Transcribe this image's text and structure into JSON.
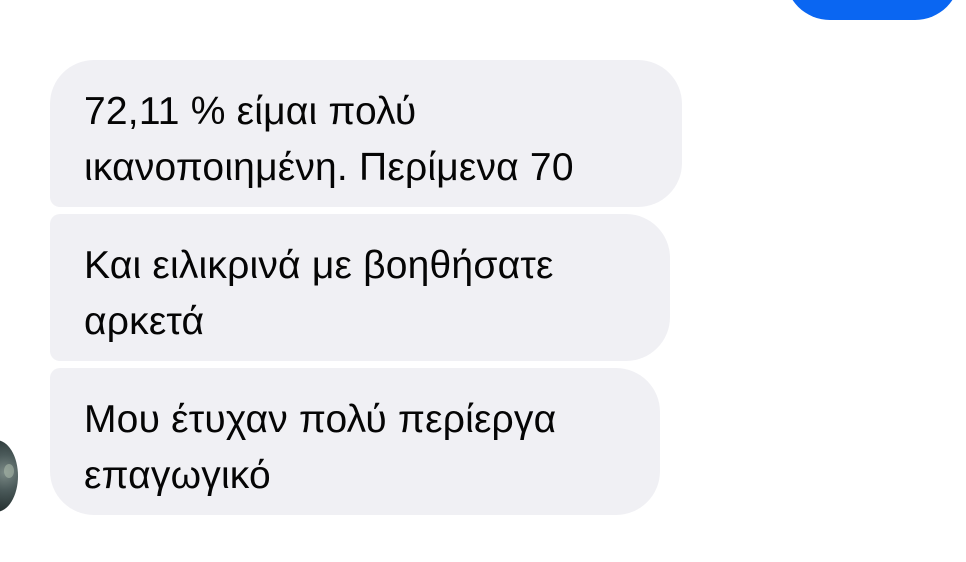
{
  "conversation": {
    "messages": [
      {
        "lines": [
          "72,11 % είμαι πολύ",
          "ικανοποιημένη. Περίμενα 70"
        ]
      },
      {
        "lines": [
          "Και ειλικρινά με βοηθήσατε",
          "αρκετά"
        ]
      },
      {
        "lines": [
          "Μου έτυχαν πολύ περίεργα",
          "επαγωγικό"
        ]
      }
    ]
  },
  "colors": {
    "sent_bubble": "#0a66f2",
    "received_bubble": "#f0f0f4",
    "background": "#ffffff",
    "text": "#050505"
  }
}
